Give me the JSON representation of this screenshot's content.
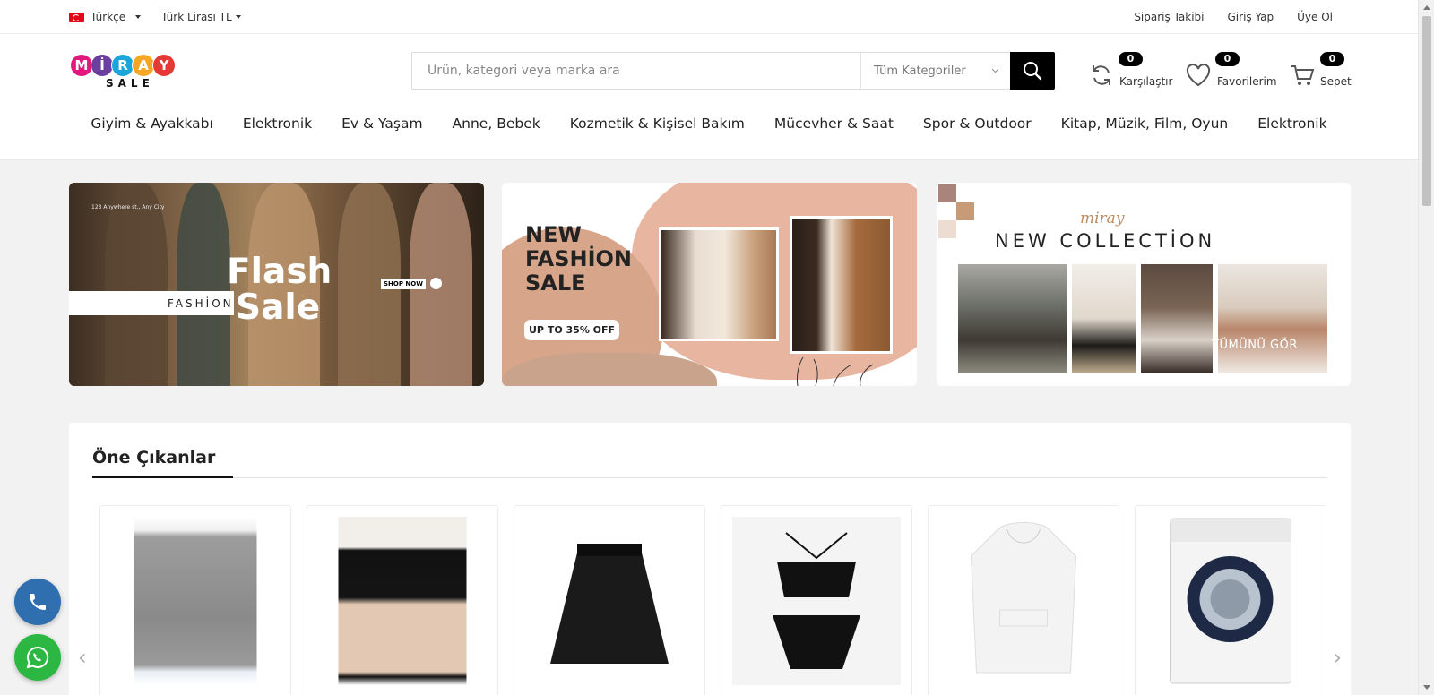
{
  "topbar": {
    "language": "Türkçe",
    "currency": "Türk Lirası TL",
    "links": [
      "Sipariş Takibi",
      "Giriş Yap",
      "Üye Ol"
    ]
  },
  "logo": {
    "letters": [
      "M",
      "İ",
      "R",
      "A",
      "Y"
    ],
    "letter_colors": [
      "#e2187f",
      "#6b3fa0",
      "#1aa6d8",
      "#f5a623",
      "#e53935"
    ],
    "subtitle": "SALE"
  },
  "search": {
    "placeholder": "Ürün, kategori veya marka ara",
    "category": "Tüm Kategoriler"
  },
  "header_actions": {
    "compare": {
      "label": "Karşılaştır",
      "count": "0"
    },
    "favorites": {
      "label": "Favorilerim",
      "count": "0"
    },
    "cart": {
      "label": "Sepet",
      "count": "0"
    }
  },
  "nav": [
    "Giyim & Ayakkabı",
    "Elektronik",
    "Ev & Yaşam",
    "Anne, Bebek",
    "Kozmetik & Kişisel Bakım",
    "Mücevher & Saat",
    "Spor & Outdoor",
    "Kitap, Müzik, Film, Oyun",
    "Elektronik"
  ],
  "banners": {
    "flash": {
      "address": "123 Anywhere st., Any City",
      "tag": "FASHİON",
      "title_line1": "Flash",
      "title_line2": "Sale",
      "cta": "SHOP NOW"
    },
    "fashion": {
      "title_line1": "NEW",
      "title_line2": "FASHİON",
      "title_line3": "SALE",
      "offer": "UP TO 35% OFF"
    },
    "collection": {
      "script": "miray",
      "title": "NEW COLLECTİON",
      "cta": "TÜMÜNÜ GÖR"
    }
  },
  "featured": {
    "title": "Öne Çıkanlar",
    "products": [
      {
        "name": "grey-leggings"
      },
      {
        "name": "black-skirt"
      },
      {
        "name": "black-lace-skirt"
      },
      {
        "name": "black-bikini"
      },
      {
        "name": "white-hoodie"
      },
      {
        "name": "washing-machine"
      }
    ]
  },
  "colors": {
    "accent": "#000000",
    "phone_fab": "#2f6fb0",
    "whatsapp_fab": "#2cb742"
  }
}
